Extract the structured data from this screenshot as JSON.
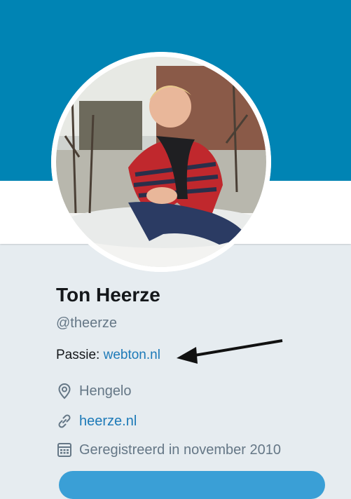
{
  "profile": {
    "name": "Ton Heerze",
    "handle": "@theerze",
    "bio_prefix": "Passie: ",
    "bio_link": "webton.nl",
    "location": "Hengelo",
    "website": "heerze.nl",
    "joined": "Geregistreerd in november 2010"
  },
  "icons": {
    "location": "location-pin-icon",
    "website": "link-icon",
    "joined": "calendar-icon"
  },
  "colors": {
    "banner": "#0084b4",
    "link": "#1d7ab8",
    "text": "#14171a",
    "muted": "#657786",
    "background": "#e6ecf0"
  }
}
